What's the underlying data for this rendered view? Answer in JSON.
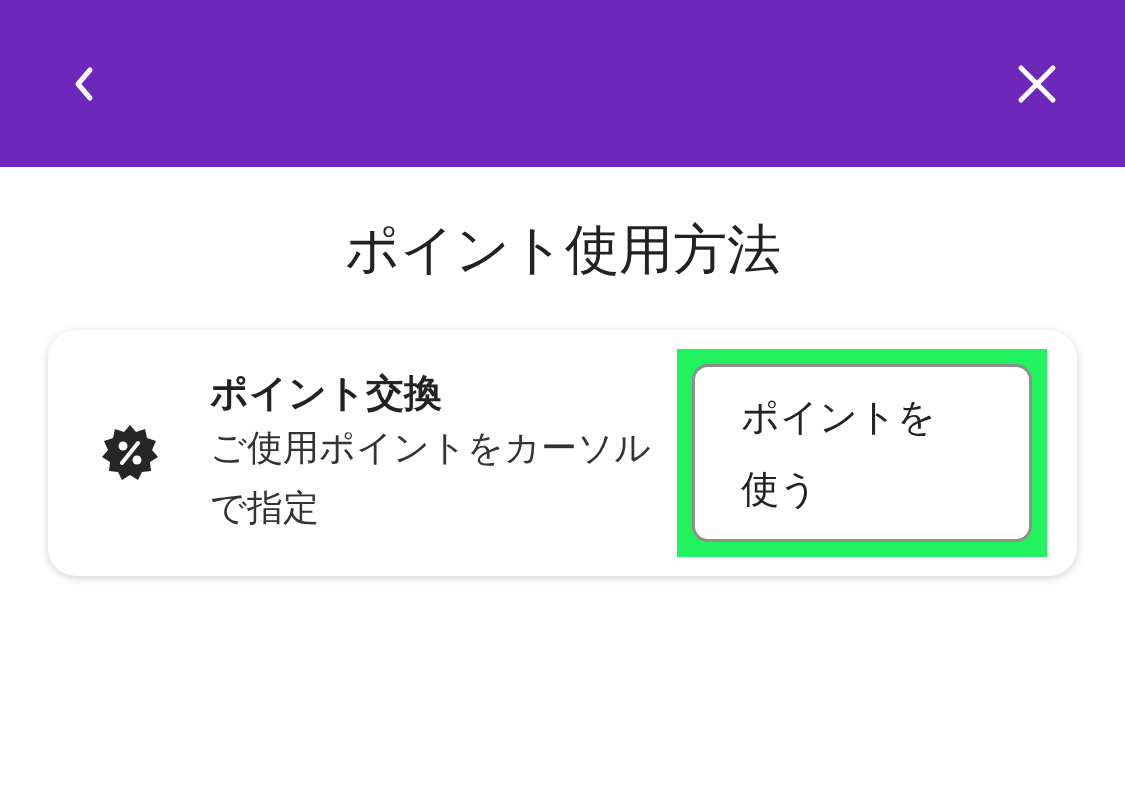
{
  "title": "ポイント使用方法",
  "card": {
    "title": "ポイント交換",
    "description": "ご使用ポイントをカーソルで指定",
    "button": {
      "label": "ポイントを使う",
      "highlighted": true
    }
  }
}
